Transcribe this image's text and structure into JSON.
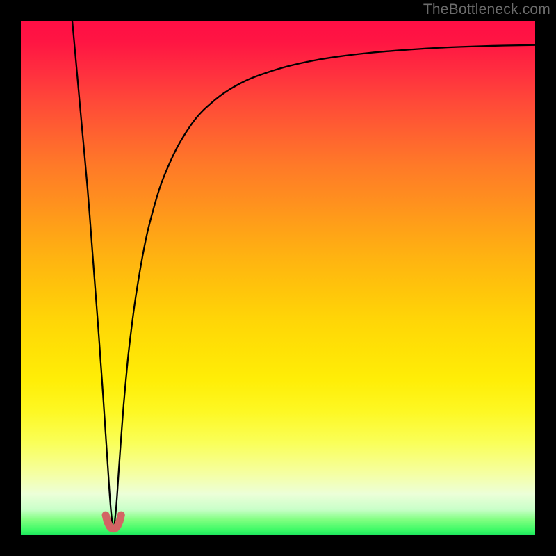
{
  "watermark": "TheBottleneck.com",
  "colors": {
    "curve": "#000000",
    "marker": "#d36464",
    "frame": "#000000"
  },
  "chart_data": {
    "type": "line",
    "title": "",
    "xlabel": "",
    "ylabel": "",
    "xlim": [
      0,
      100
    ],
    "ylim": [
      0,
      100
    ],
    "notch_x": 18,
    "series": [
      {
        "name": "bottleneck-curve",
        "x": [
          10,
          11,
          12,
          13,
          14,
          15,
          15.5,
          16,
          16.5,
          17,
          17.3,
          17.6,
          18,
          18.4,
          18.7,
          19,
          19.5,
          20,
          20.5,
          21,
          22,
          23,
          24,
          25,
          27,
          29,
          31,
          34,
          37,
          40,
          44,
          48,
          52,
          57,
          62,
          68,
          74,
          80,
          87,
          94,
          100
        ],
        "y": [
          100,
          89,
          78,
          67,
          54,
          41,
          34,
          27,
          19.5,
          12,
          7.5,
          4,
          1.3,
          4,
          7.5,
          12,
          19,
          25.5,
          31,
          36,
          44,
          50.5,
          56,
          60.5,
          67.5,
          72.5,
          76.5,
          81,
          84,
          86.3,
          88.5,
          90,
          91.2,
          92.3,
          93.1,
          93.8,
          94.3,
          94.7,
          95.0,
          95.2,
          95.3
        ]
      }
    ],
    "marker": {
      "name": "notch-u-marker",
      "x": [
        16.5,
        16.8,
        17.2,
        17.6,
        18.0,
        18.4,
        18.8,
        19.2,
        19.5
      ],
      "y": [
        3.9,
        2.7,
        1.8,
        1.35,
        1.25,
        1.35,
        1.8,
        2.7,
        3.9
      ]
    }
  }
}
